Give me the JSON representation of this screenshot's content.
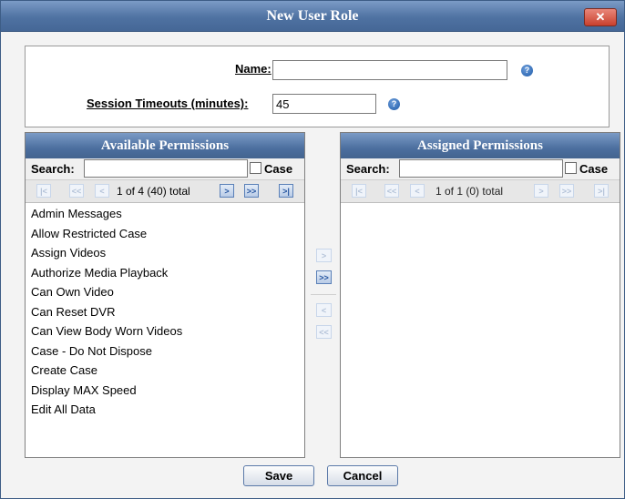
{
  "dialog": {
    "title": "New User Role",
    "close_glyph": "✕"
  },
  "form": {
    "name_label": "Name:",
    "name_value": "",
    "session_label": "Session Timeouts (minutes):",
    "session_value": "45",
    "help_glyph": "?"
  },
  "available": {
    "title": "Available Permissions",
    "search_label": "Search:",
    "search_value": "",
    "case_label": "Case",
    "case_checked": false,
    "page_text": "1 of 4 (40) total",
    "items": [
      "Admin Messages",
      "Allow Restricted Case",
      "Assign Videos",
      "Authorize Media Playback",
      "Can Own Video",
      "Can Reset DVR",
      "Can View Body Worn Videos",
      "Case - Do Not Dispose",
      "Create Case",
      "Display MAX Speed",
      "Edit All Data"
    ]
  },
  "assigned": {
    "title": "Assigned Permissions",
    "search_label": "Search:",
    "search_value": "",
    "case_label": "Case",
    "case_checked": false,
    "page_text": "1 of 1 (0) total",
    "items": []
  },
  "pager_glyphs": {
    "first": "|<",
    "prev_page": "<<",
    "prev": "<",
    "next": ">",
    "next_page": ">>",
    "last": ">|"
  },
  "movers": {
    "add_one": ">",
    "add_all": ">>",
    "remove_one": "<",
    "remove_all": "<<"
  },
  "buttons": {
    "save": "Save",
    "cancel": "Cancel"
  },
  "colors": {
    "header_blue": "#4f72a2",
    "button_blue": "#2756a0",
    "close_red": "#c9402e"
  }
}
